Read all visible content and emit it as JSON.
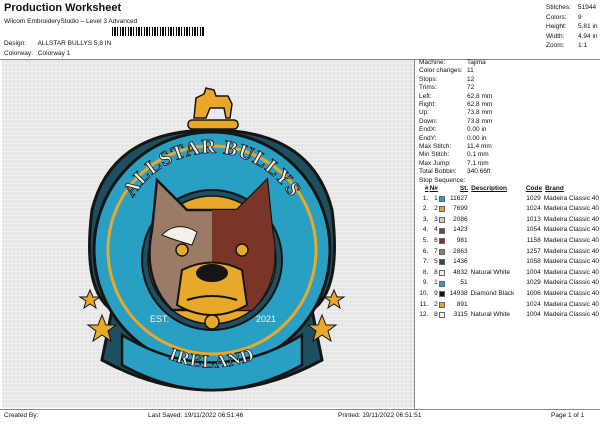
{
  "header": {
    "title": "Production Worksheet",
    "subtitle": "Wilcom EmbroideryStudio – Level 3 Advanced",
    "design_label": "Design:",
    "design_value": "ALLSTAR BULLYS 5,8 IN",
    "colorway_label": "Colorway:",
    "colorway_value": "Colorway 1"
  },
  "summary": [
    {
      "label": "Stitches:",
      "value": "51944"
    },
    {
      "label": "Colors:",
      "value": "9"
    },
    {
      "label": "Height:",
      "value": "5.81 in"
    },
    {
      "label": "Width:",
      "value": "4.94 in"
    },
    {
      "label": "Zoom:",
      "value": "1:1"
    }
  ],
  "machine_info": [
    {
      "label": "Machine:",
      "value": "Tajima"
    },
    {
      "label": "Color changes:",
      "value": "11"
    },
    {
      "label": "Stops:",
      "value": "12"
    },
    {
      "label": "Trims:",
      "value": "72"
    },
    {
      "label": "Left:",
      "value": "62.8 mm"
    },
    {
      "label": "Right:",
      "value": "62.8 mm"
    },
    {
      "label": "Up:",
      "value": "73.8 mm"
    },
    {
      "label": "Down:",
      "value": "73.8 mm"
    },
    {
      "label": "EndX:",
      "value": "0.00 in"
    },
    {
      "label": "EndY:",
      "value": "0.00 in"
    },
    {
      "label": "Max Stitch:",
      "value": "11.4 mm"
    },
    {
      "label": "Min Stitch:",
      "value": "0.1 mm"
    },
    {
      "label": "Max Jump:",
      "value": "7.1 mm"
    },
    {
      "label": "Total Bobbin:",
      "value": "340.66ft"
    }
  ],
  "stop_sequence": {
    "title": "Stop Sequence:",
    "headers": {
      "num": "#",
      "n": "N#",
      "st": "St.",
      "desc": "Description",
      "code": "Code",
      "brand": "Brand"
    },
    "rows": [
      {
        "num": "1.",
        "n": "1",
        "color": "#2a9fc4",
        "st": "11627",
        "desc": "",
        "code": "1029",
        "brand": "Madeira Classic 40"
      },
      {
        "num": "2.",
        "n": "2",
        "color": "#e8a82a",
        "st": "7699",
        "desc": "",
        "code": "1024",
        "brand": "Madeira Classic 40"
      },
      {
        "num": "3.",
        "n": "3",
        "color": "#c9d2d8",
        "st": "2086",
        "desc": "",
        "code": "1013",
        "brand": "Madeira Classic 40"
      },
      {
        "num": "4.",
        "n": "4",
        "color": "#6e4a34",
        "st": "1423",
        "desc": "",
        "code": "1054",
        "brand": "Madeira Classic 40"
      },
      {
        "num": "5.",
        "n": "6",
        "color": "#7a3528",
        "st": "981",
        "desc": "",
        "code": "1158",
        "brand": "Madeira Classic 40"
      },
      {
        "num": "6.",
        "n": "7",
        "color": "#9a7b68",
        "st": "2863",
        "desc": "",
        "code": "1257",
        "brand": "Madeira Classic 40"
      },
      {
        "num": "7.",
        "n": "5",
        "color": "#1e4f60",
        "st": "1436",
        "desc": "",
        "code": "1058",
        "brand": "Madeira Classic 40"
      },
      {
        "num": "8.",
        "n": "8",
        "color": "#f4f1e8",
        "st": "4832",
        "desc": "Natural White",
        "code": "1004",
        "brand": "Madeira Classic 40"
      },
      {
        "num": "9.",
        "n": "1",
        "color": "#2a9fc4",
        "st": "51",
        "desc": "",
        "code": "1029",
        "brand": "Madeira Classic 40"
      },
      {
        "num": "10.",
        "n": "9",
        "color": "#151515",
        "st": "14938",
        "desc": "Diamond Black",
        "code": "1006",
        "brand": "Madeira Classic 40"
      },
      {
        "num": "11.",
        "n": "2",
        "color": "#e8a82a",
        "st": "891",
        "desc": "",
        "code": "1024",
        "brand": "Madeira Classic 40"
      },
      {
        "num": "12.",
        "n": "8",
        "color": "#f4f1e8",
        "st": "3115",
        "desc": "Natural White",
        "code": "1004",
        "brand": "Madeira Classic 40"
      }
    ]
  },
  "design": {
    "top_text": "ALLSTAR BULLYS",
    "bottom_text": "IRELAND",
    "est_label": "EST.",
    "year": "2021",
    "colors": {
      "blue": "#2a9fc4",
      "dark_blue": "#1e4f60",
      "gold": "#e8a82a",
      "black": "#151515",
      "white": "#f4f1e8",
      "brown": "#7a3528",
      "light_brown": "#9a7b68"
    }
  },
  "footer": {
    "created_by": "Created By:",
    "last_saved": "Last Saved: 19/11/2022 06:51:46",
    "printed": "Printed: 19/11/2022 06:51:51",
    "page": "Page 1 of 1"
  }
}
